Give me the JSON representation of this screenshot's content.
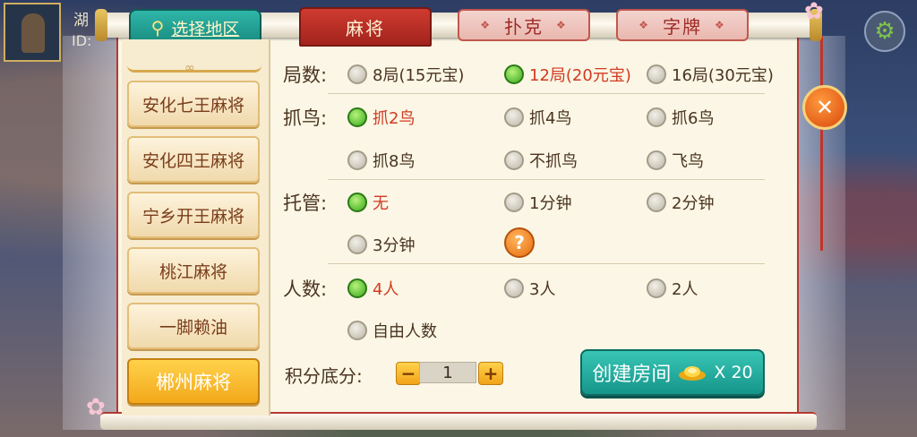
{
  "player": {
    "id_line1": "湖",
    "id_line2": "ID:"
  },
  "icons": {
    "settings": "gear-icon",
    "location": "map-pin-icon",
    "close": "close-icon",
    "help": "question-icon",
    "currency": "gold-ingot-icon"
  },
  "region_button": {
    "label": "选择地区"
  },
  "tabs": [
    {
      "label": "麻将",
      "active": true
    },
    {
      "label": "扑克",
      "active": false
    },
    {
      "label": "字牌",
      "active": false
    }
  ],
  "game_list": [
    {
      "label": "安化七王麻将",
      "selected": false
    },
    {
      "label": "安化四王麻将",
      "selected": false
    },
    {
      "label": "宁乡开王麻将",
      "selected": false
    },
    {
      "label": "桃江麻将",
      "selected": false
    },
    {
      "label": "一脚赖油",
      "selected": false
    },
    {
      "label": "郴州麻将",
      "selected": true
    }
  ],
  "form": {
    "rounds": {
      "label": "局数:",
      "options": [
        "8局(15元宝)",
        "12局(20元宝)",
        "16局(30元宝)"
      ],
      "selected_index": 1
    },
    "birds": {
      "label": "抓鸟:",
      "options": [
        "抓2鸟",
        "抓4鸟",
        "抓6鸟",
        "抓8鸟",
        "不抓鸟",
        "飞鸟"
      ],
      "selected_index": 0
    },
    "trustee": {
      "label": "托管:",
      "options": [
        "无",
        "1分钟",
        "2分钟",
        "3分钟"
      ],
      "selected_index": 0
    },
    "players": {
      "label": "人数:",
      "options": [
        "4人",
        "3人",
        "2人",
        "自由人数"
      ],
      "selected_index": 0
    },
    "score": {
      "label": "积分底分:",
      "value": "1",
      "minus": "−",
      "plus": "+"
    }
  },
  "create_button": {
    "label": "创建房间",
    "cost": "X 20"
  },
  "colors": {
    "accent_red": "#d23a22",
    "teal": "#1aa394",
    "gold": "#f3a81b"
  }
}
